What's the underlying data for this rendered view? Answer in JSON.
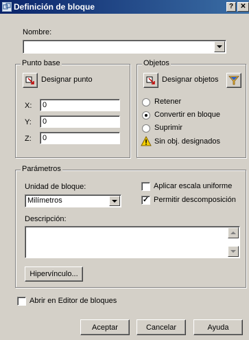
{
  "window": {
    "title": "Definición de bloque",
    "help_button": "?",
    "close_button": "✕"
  },
  "name": {
    "label": "Nombre:",
    "value": ""
  },
  "base_point": {
    "group_label": "Punto base",
    "pick_button": "Designar punto",
    "x_label": "X:",
    "x_value": "0",
    "y_label": "Y:",
    "y_value": "0",
    "z_label": "Z:",
    "z_value": "0"
  },
  "objects": {
    "group_label": "Objetos",
    "select_button": "Designar objetos",
    "options": [
      "Retener",
      "Convertir en bloque",
      "Suprimir"
    ],
    "selected_option": "Convertir en bloque",
    "warning_text": "Sin obj. designados"
  },
  "settings": {
    "group_label": "Parámetros",
    "unit_label": "Unidad de bloque:",
    "unit_value": "Milímetros",
    "uniform_scale_label": "Aplicar escala uniforme",
    "uniform_scale_checked": false,
    "allow_explode_label": "Permitir descomposición",
    "allow_explode_checked": true,
    "description_label": "Descripción:",
    "description_value": "",
    "hyperlink_button": "Hipervínculo..."
  },
  "open_in_editor": {
    "label": "Abrir en Editor de bloques",
    "checked": false
  },
  "footer": {
    "ok_button": "Aceptar",
    "cancel_button": "Cancelar",
    "help_button": "Ayuda"
  },
  "colors": {
    "title_start": "#0a246a",
    "title_end": "#3b6ea5",
    "dialog_bg": "#d4d0c8",
    "warning_yellow": "#f5d000"
  }
}
